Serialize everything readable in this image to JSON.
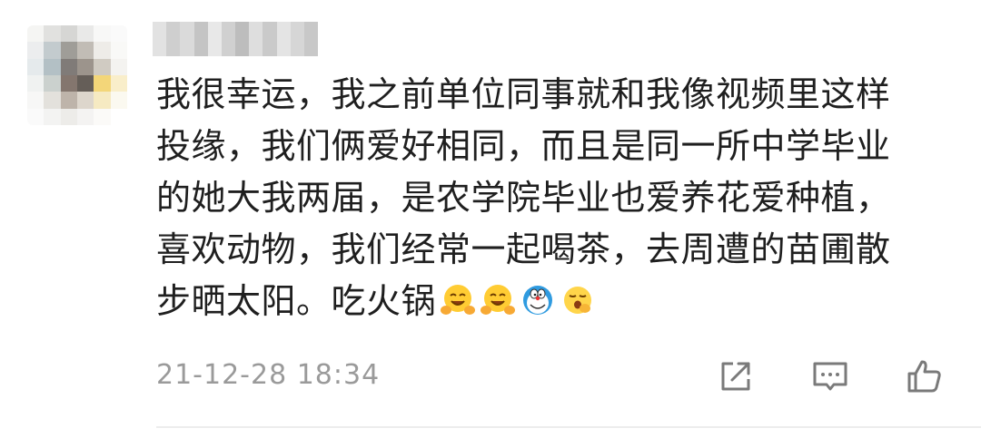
{
  "comment": {
    "text_lines": [
      "我很幸运，我之前单位同事就和我像视频里这样",
      "投缘，我们俩爱好相同，而且是同一所中学毕业",
      "的她大我两届，是农学院毕业也爱养花爱种植，",
      "喜欢动物，我们经常一起喝茶，去周遭的苗圃散",
      "步晒太阳。吃火锅"
    ],
    "emojis": [
      "hug-emoji",
      "hug-emoji",
      "doraemon-emoji",
      "yawn-emoji"
    ],
    "timestamp": "21-12-28 18:34"
  },
  "actions": [
    {
      "name": "share-icon"
    },
    {
      "name": "reply-comment-icon"
    },
    {
      "name": "like-icon"
    }
  ],
  "colors": {
    "text": "#1f1f1f",
    "meta": "#9a9a9a",
    "icon": "#7a7a7a",
    "divider": "#ededed"
  }
}
